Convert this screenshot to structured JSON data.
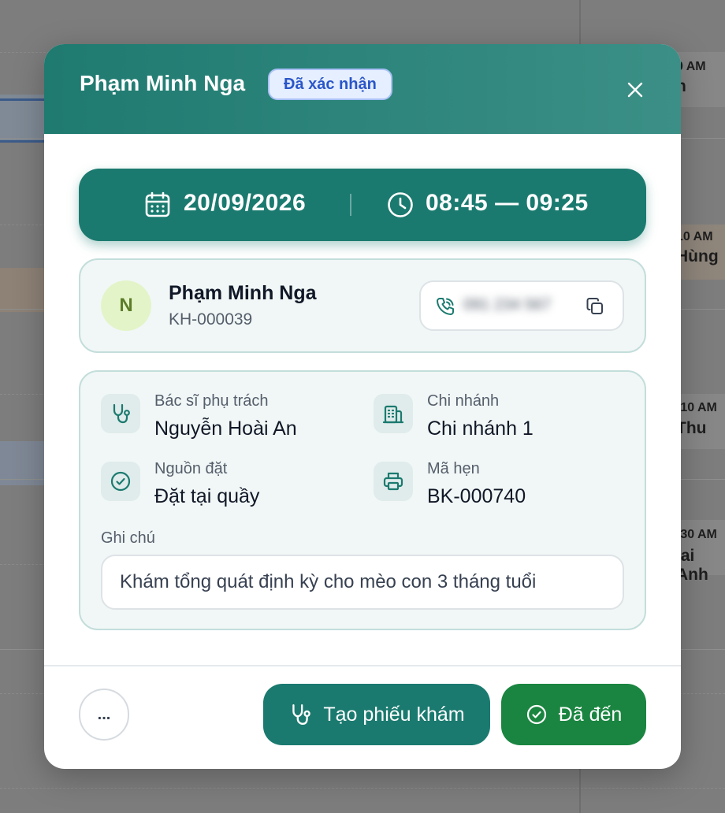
{
  "background": {
    "events": [
      {
        "time": "0 AM",
        "name": "n"
      },
      {
        "time": "10 AM",
        "name": "Hùng"
      },
      {
        "time": ":10 AM",
        "name": "Thu"
      },
      {
        "time": ":30 AM",
        "name": "lai Anh"
      }
    ]
  },
  "modal": {
    "title": "Phạm Minh Nga",
    "status": "Đã xác nhận",
    "date": "20/09/2026",
    "time_range": "08:45 — 09:25",
    "customer": {
      "initial": "N",
      "name": "Phạm Minh Nga",
      "code": "KH-000039",
      "phone": "091 234 567"
    },
    "details": {
      "doctor_label": "Bác sĩ phụ trách",
      "doctor_value": "Nguyễn Hoài An",
      "branch_label": "Chi nhánh",
      "branch_value": "Chi nhánh 1",
      "source_label": "Nguồn đặt",
      "source_value": "Đặt tại quầy",
      "booking_label": "Mã hẹn",
      "booking_value": "BK-000740",
      "note_label": "Ghi chú",
      "note_value": "Khám tổng quát định kỳ cho mèo con 3 tháng tuổi"
    },
    "actions": {
      "more": "...",
      "create_exam": "Tạo phiếu khám",
      "arrived": "Đã đến"
    }
  },
  "colors": {
    "primary": "#1b7a6f",
    "success": "#1a8540",
    "badge_text": "#2a56c9",
    "badge_bg": "#e6efff"
  },
  "icons": [
    "calendar-icon",
    "clock-icon",
    "phone-icon",
    "copy-icon",
    "stethoscope-icon",
    "building-icon",
    "check-circle-icon",
    "printer-icon",
    "close-icon"
  ]
}
